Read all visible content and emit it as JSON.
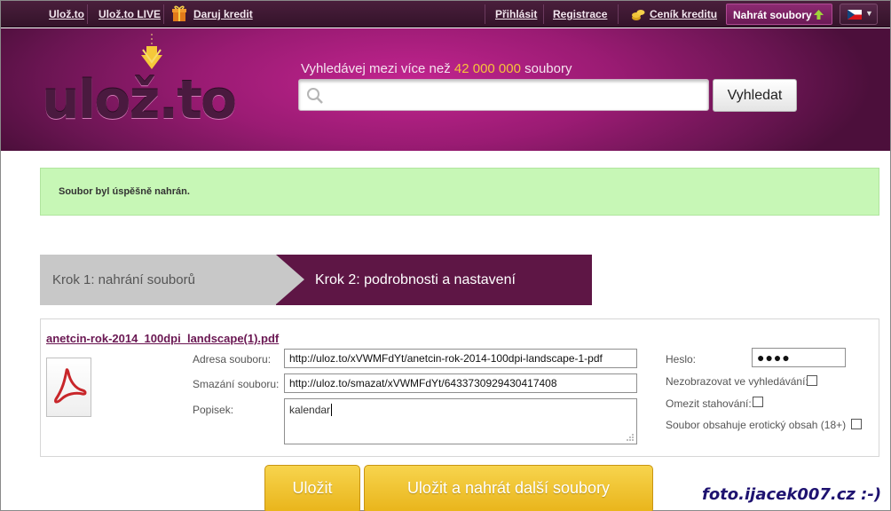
{
  "topbar": {
    "links": [
      "Ulož.to",
      "Ulož.to LIVE",
      "Daruj kredit"
    ],
    "login": "Přihlásit",
    "register": "Registrace",
    "pricing": "Ceník kreditu",
    "upload": "Nahrát soubory"
  },
  "header": {
    "logo": "ulož.to",
    "search_caption_prefix": "Vyhledávej mezi více než",
    "search_caption_count": "42 000 000",
    "search_caption_suffix": "soubory",
    "search_placeholder": "",
    "search_button": "Vyhledat"
  },
  "success_message": "Soubor byl úspěšně nahrán.",
  "steps": [
    {
      "label": "Krok 1: nahrání souborů",
      "active": false
    },
    {
      "label": "Krok 2: podrobnosti a nastavení",
      "active": true
    }
  ],
  "file": {
    "name": "anetcin-rok-2014_100dpi_landscape(1).pdf",
    "address_label": "Adresa souboru:",
    "address_value": "http://uloz.to/xVWMFdYt/anetcin-rok-2014-100dpi-landscape-1-pdf",
    "delete_label": "Smazání souboru:",
    "delete_value": "http://uloz.to/smazat/xVWMFdYt/6433730929430417408",
    "description_label": "Popisek:",
    "description_value": "kalendar",
    "password_label": "Heslo:",
    "password_value": "●●●●",
    "hide_label": "Nezobrazovat ve vyhledávání:",
    "limit_label": "Omezit stahování:",
    "erotic_label": "Soubor obsahuje erotický obsah (18+)"
  },
  "buttons": {
    "save": "Uložit",
    "save_and_upload": "Uložit a nahrát další soubory"
  },
  "watermark": "foto.ijacek007.cz :-)",
  "colors": {
    "brand": "#5e1645",
    "accent": "#f6c33a",
    "success_bg": "#c7f7b6"
  }
}
